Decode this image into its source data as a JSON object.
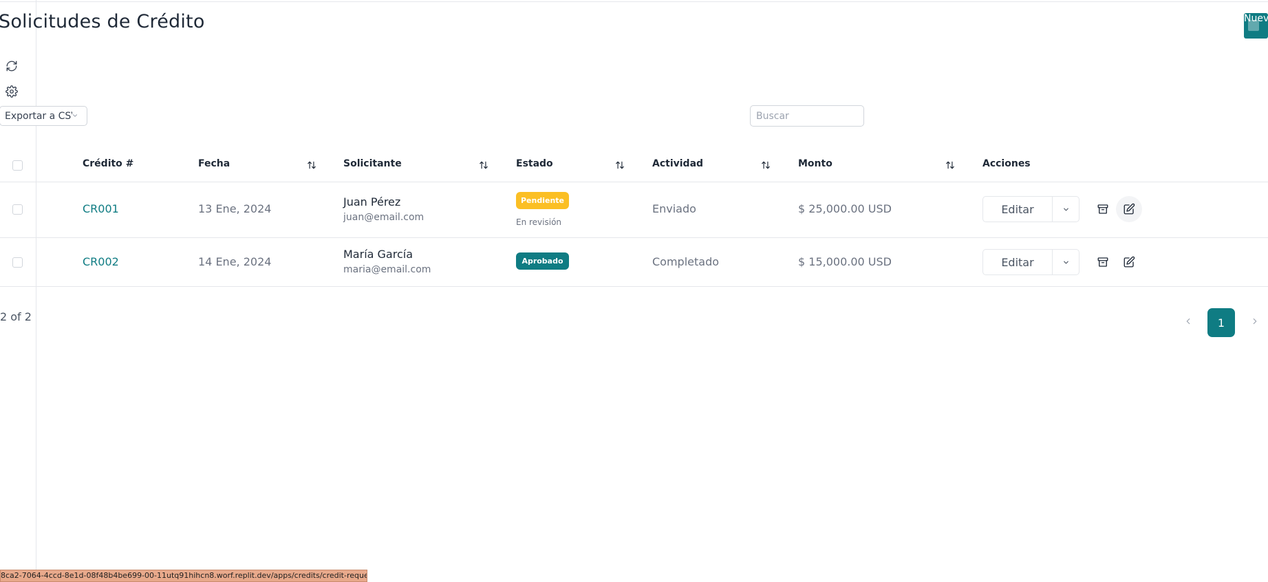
{
  "page": {
    "title": "Solicitudes de Crédito",
    "new_button_label": "Nueva solicitud"
  },
  "toolbar": {
    "export_label": "Exportar a CSV",
    "search_placeholder": "Buscar",
    "refresh_icon": "refresh-icon",
    "settings_icon": "gear-icon"
  },
  "table": {
    "columns": [
      "Crédito #",
      "Fecha",
      "Solicitante",
      "Estado",
      "Actividad",
      "Monto",
      "Acciones"
    ],
    "rows": [
      {
        "credit": "CR001",
        "date": "13 Ene, 2024",
        "applicant_name": "Juan Pérez",
        "applicant_email": "juan@email.com",
        "status": "Pendiente",
        "status_color": "#fbbf24",
        "status_detail": "En revisión",
        "activity": "Enviado",
        "amount": "$ 25,000.00 USD",
        "edit_label": "Editar"
      },
      {
        "credit": "CR002",
        "date": "14 Ene, 2024",
        "applicant_name": "María García",
        "applicant_email": "maria@email.com",
        "status": "Aprobado",
        "status_color": "#0f7c83",
        "status_detail": "",
        "activity": "Completado",
        "amount": "$ 15,000.00 USD",
        "edit_label": "Editar"
      }
    ]
  },
  "pagination": {
    "count_text": "2 of 2",
    "current_page": "1"
  },
  "status_bar": {
    "url": "8ca2-7064-4ccd-8e1d-08f48b4be699-00-11utq91hihcn8.worf.replit.dev/apps/credits/credit-request#"
  },
  "colors": {
    "accent": "#0f7c83",
    "pending": "#fbbf24"
  }
}
